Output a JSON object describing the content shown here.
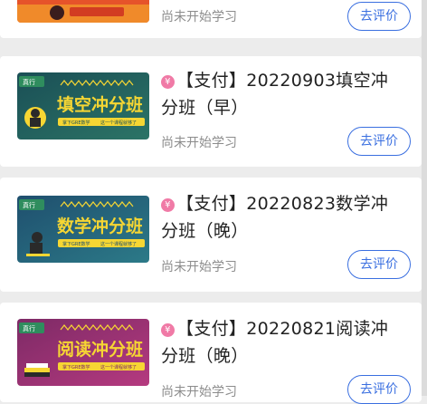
{
  "courses": [
    {
      "title": "",
      "status": "尚未开始学习",
      "button": "去评价",
      "thumb": {
        "headline": "",
        "bg1": "#f08a2a",
        "bg2": "#e2522a",
        "logo": "",
        "slogan_left": "",
        "slogan_right": ""
      }
    },
    {
      "title": "【支付】20220903填空冲分班（早）",
      "status": "尚未开始学习",
      "button": "去评价",
      "thumb": {
        "headline": "填空冲分班",
        "bg1": "#1f5c5e",
        "bg2": "#2b6f63",
        "logo": "真行",
        "slogan_left": "掌下GRE数学",
        "slogan_right": "这一个课程就够了"
      }
    },
    {
      "title": "【支付】20220823数学冲分班（晚）",
      "status": "尚未开始学习",
      "button": "去评价",
      "thumb": {
        "headline": "数学冲分班",
        "bg1": "#225a7a",
        "bg2": "#2a6f86",
        "logo": "真行",
        "slogan_left": "掌下GRE数学",
        "slogan_right": "这一个课程就够了"
      }
    },
    {
      "title": "【支付】20220821阅读冲分班（晚）",
      "status": "尚未开始学习",
      "button": "去评价",
      "thumb": {
        "headline": "阅读冲分班",
        "bg1": "#8a2d6a",
        "bg2": "#b0357a",
        "logo": "真行",
        "slogan_left": "掌下GRE数学",
        "slogan_right": "这一个课程就够了"
      }
    }
  ],
  "icons": {
    "price_badge": "yen-badge-icon"
  },
  "colors": {
    "accent": "#3a6fe0",
    "badge": "#f07aa6",
    "headline_yellow": "#f6d633"
  }
}
